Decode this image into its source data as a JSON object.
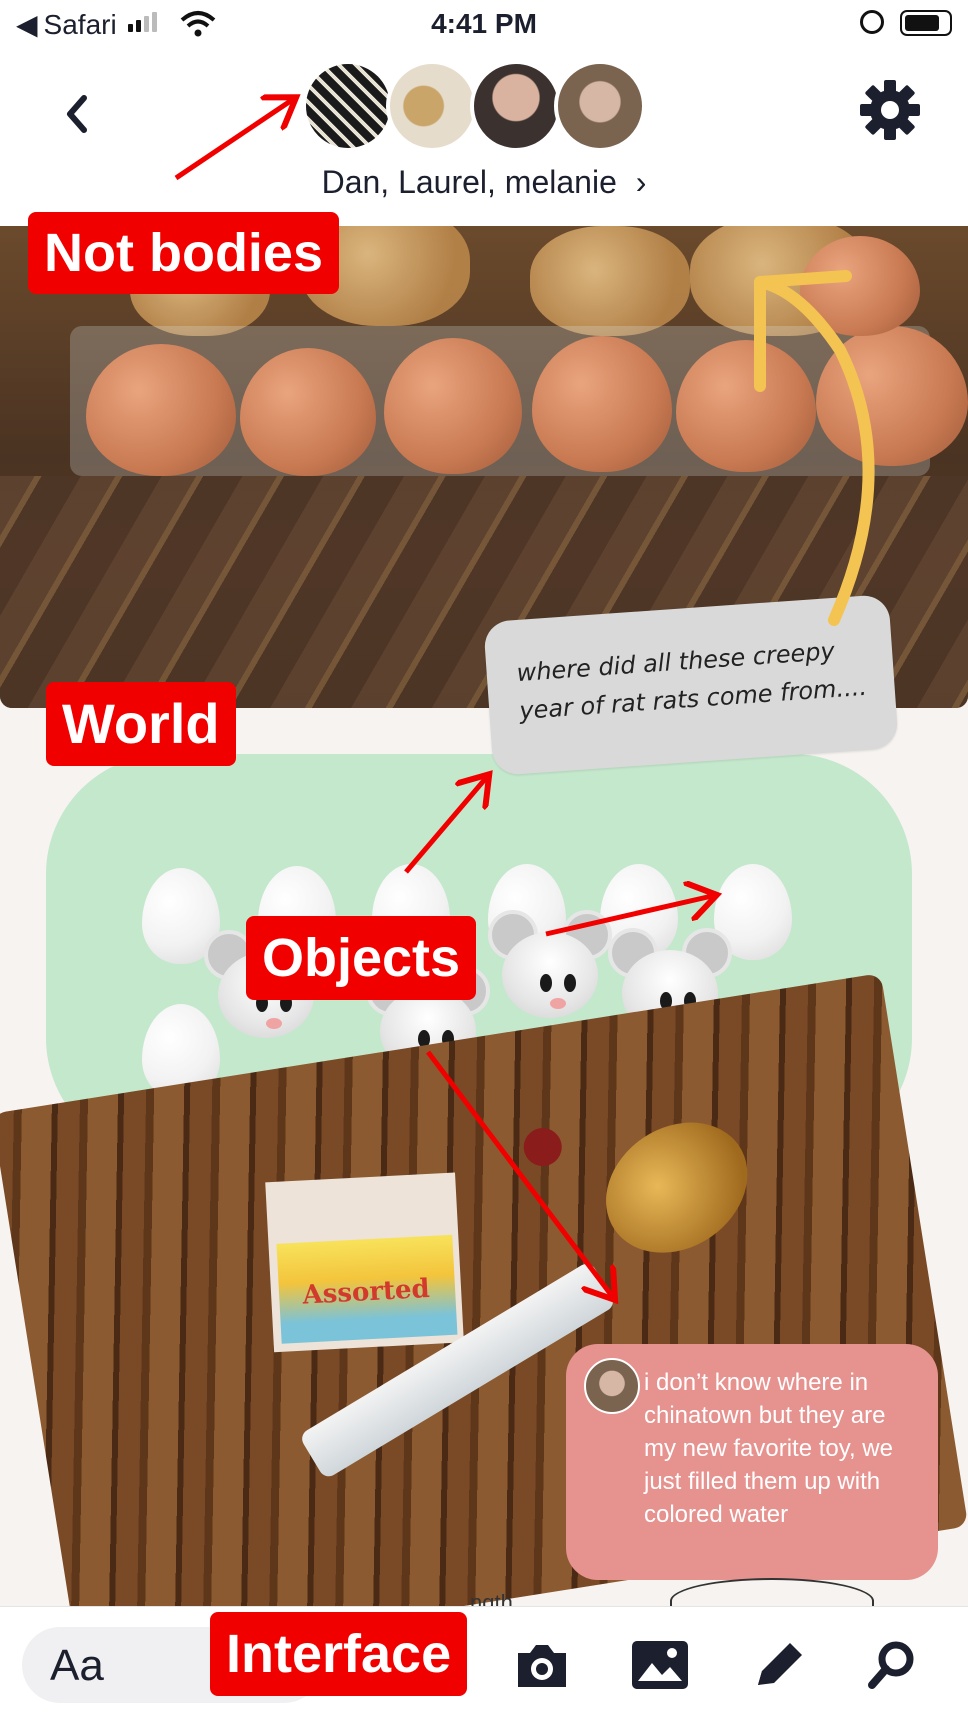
{
  "status_bar": {
    "back_app": "Safari",
    "time": "4:41 PM"
  },
  "header": {
    "participants": "Dan, Laurel, melanie",
    "chevron": "›"
  },
  "messages": {
    "grey_note": "where did all these creepy year of rat rats come from....",
    "pink_message": "i don’t know where in chinatown but they are my new favorite toy, we just filled them up with colored water"
  },
  "photo2": {
    "box_brand": "Assorted"
  },
  "sketch_text": "ngth",
  "composer": {
    "text_button": "Aa"
  },
  "annotations": {
    "not_bodies": "Not bodies",
    "world": "World",
    "objects": "Objects",
    "interface": "Interface"
  },
  "colors": {
    "annotation_red": "#f10000",
    "green_bubble": "#c4e8cc",
    "pink_bubble": "#e6928f",
    "arrow_yellow": "#f4c452"
  },
  "icons": [
    "back-chevron-icon",
    "gear-icon",
    "camera-icon",
    "image-icon",
    "pencil-icon",
    "search-icon",
    "wifi-icon",
    "battery-icon"
  ]
}
